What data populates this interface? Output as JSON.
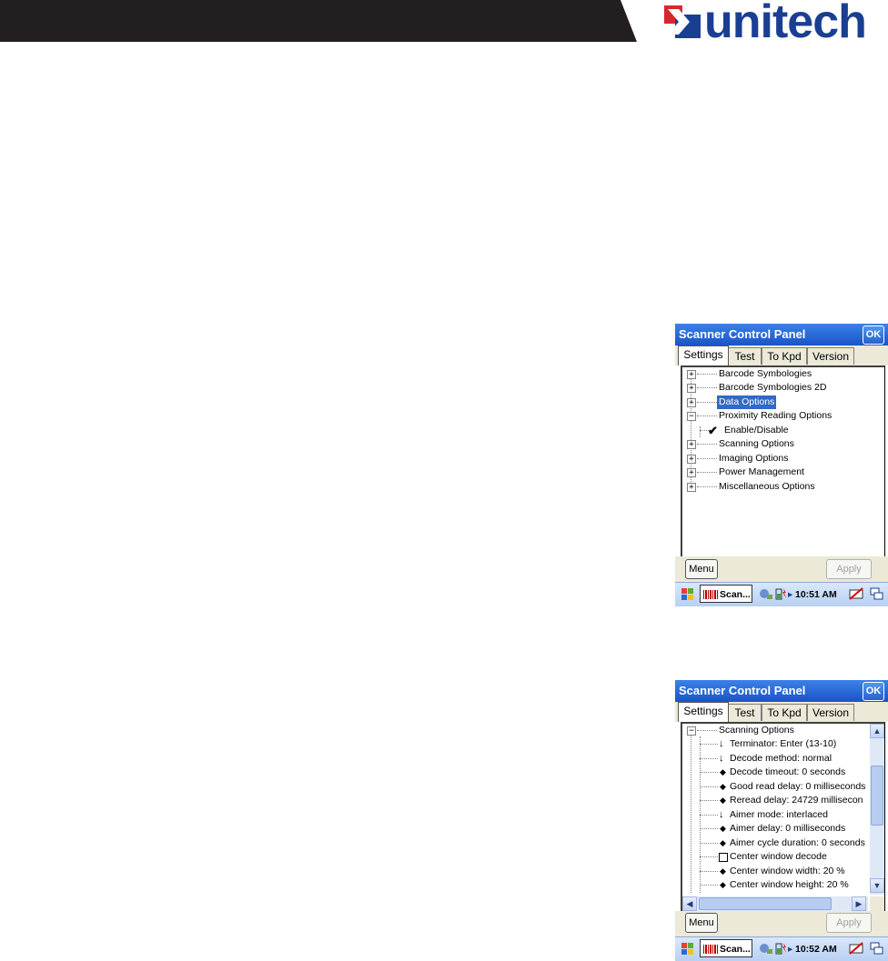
{
  "brand": {
    "logo_text": "unitech"
  },
  "screens": [
    {
      "title": "Scanner Control Panel",
      "ok_label": "OK",
      "tabs": [
        "Settings",
        "Test",
        "To Kpd",
        "Version"
      ],
      "tree": [
        {
          "label": "Barcode Symbologies",
          "expander": "+"
        },
        {
          "label": "Barcode Symbologies 2D",
          "expander": "+"
        },
        {
          "label": "Data Options",
          "expander": "+",
          "selected": true
        },
        {
          "label": "Proximity Reading Options",
          "expander": "−"
        },
        {
          "label": "Enable/Disable",
          "child": true,
          "check": true
        },
        {
          "label": "Scanning Options",
          "expander": "+"
        },
        {
          "label": "Imaging Options",
          "expander": "+"
        },
        {
          "label": "Power Management",
          "expander": "+"
        },
        {
          "label": "Miscellaneous Options",
          "expander": "+"
        }
      ],
      "menu_label": "Menu",
      "apply_label": "Apply",
      "taskbar": {
        "task_label": "Scan...",
        "clock": "10:51 AM"
      }
    },
    {
      "title": "Scanner Control Panel",
      "ok_label": "OK",
      "tabs": [
        "Settings",
        "Test",
        "To Kpd",
        "Version"
      ],
      "tree": [
        {
          "label": "Scanning Options",
          "expander": "−"
        },
        {
          "label": "Terminator: Enter (13-10)",
          "marker": "arrow"
        },
        {
          "label": "Decode method: normal",
          "marker": "arrow"
        },
        {
          "label": "Decode timeout: 0 seconds",
          "marker": "diamond"
        },
        {
          "label": "Good read delay: 0 milliseconds",
          "marker": "diamond"
        },
        {
          "label": "Reread delay: 24729 millisecon",
          "marker": "diamond"
        },
        {
          "label": "Aimer mode: interlaced",
          "marker": "arrow"
        },
        {
          "label": "Aimer delay: 0 milliseconds",
          "marker": "diamond"
        },
        {
          "label": "Aimer cycle duration: 0 seconds",
          "marker": "diamond"
        },
        {
          "label": "Center window decode",
          "marker": "box"
        },
        {
          "label": "Center window width: 20 %",
          "marker": "diamond"
        },
        {
          "label": "Center window height: 20 %",
          "marker": "diamond"
        }
      ],
      "menu_label": "Menu",
      "apply_label": "Apply",
      "taskbar": {
        "task_label": "Scan...",
        "clock": "10:52 AM"
      }
    }
  ]
}
